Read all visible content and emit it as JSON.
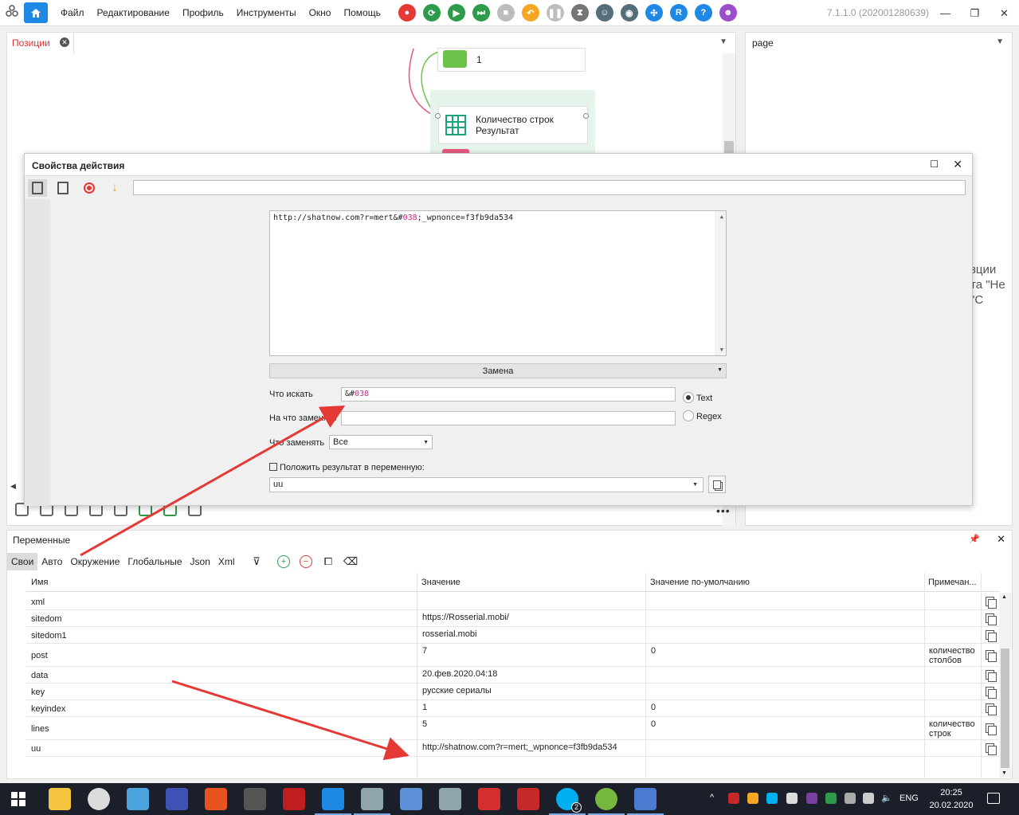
{
  "app": {
    "menu": [
      "Файл",
      "Редактирование",
      "Профиль",
      "Инструменты",
      "Окно",
      "Помощь"
    ],
    "version": "7.1.1.0 (202001280639)",
    "toolbar_letter": "R",
    "toolbar_help": "?",
    "toolbar_colors": [
      "#e53935",
      "#2e9b4a",
      "#2e9b4a",
      "#2e9b4a",
      "#bdbdbd",
      "#f5a623",
      "#bdbdbd",
      "#757575",
      "#546e7a",
      "#546e7a",
      "#1e88e5",
      "#1e88e5",
      "#1e88e5",
      "#9c4dcc"
    ]
  },
  "positions_panel": {
    "tab_label": "Позиции",
    "node1_label": "1",
    "node2_line1": "Количество строк",
    "node2_line2": "Результат"
  },
  "page_panel": {
    "title": "page",
    "partial_text": "зции\nта \"Не\n\"С"
  },
  "dialog": {
    "title": "Свойства действия",
    "comment_value": "",
    "text_prefix": "http://shatnow.com?r=mert&#",
    "text_highlight": "038",
    "text_suffix": ";_wpnonce=f3fb9da534",
    "mode": "Замена",
    "find_label": "Что искать",
    "find_prefix": "&#",
    "find_highlight": "038",
    "replace_label": "На что заменять",
    "replace_value": "",
    "radio_text": "Text",
    "radio_regex": "Regex",
    "radio_selected": "Text",
    "what_label": "Что заменять",
    "what_value": "Все",
    "result_label": "Положить результат в переменную:",
    "result_var": "uu"
  },
  "variables": {
    "title": "Переменные",
    "tabs": [
      "Свои",
      "Авто",
      "Окружение",
      "Глобальные",
      "Json",
      "Xml"
    ],
    "selected_tab": "Свои",
    "columns": [
      "Имя",
      "Значение",
      "Значение по-умолчанию",
      "Примечан..."
    ],
    "rows": [
      {
        "name": "xml",
        "value": "",
        "default": "",
        "note": ""
      },
      {
        "name": "sitedom",
        "value": "https://Rosserial.mobi/",
        "default": "",
        "note": ""
      },
      {
        "name": "sitedom1",
        "value": "rosserial.mobi",
        "default": "",
        "note": ""
      },
      {
        "name": "post",
        "value": "7",
        "default": "0",
        "note": "количество столбов"
      },
      {
        "name": "data",
        "value": "20.фев.2020.04:18",
        "default": "",
        "note": ""
      },
      {
        "name": "key",
        "value": "русские сериалы",
        "default": "",
        "note": ""
      },
      {
        "name": "keyindex",
        "value": "1",
        "default": "0",
        "note": ""
      },
      {
        "name": "lines",
        "value": "5",
        "default": "0",
        "note": "количество строк"
      },
      {
        "name": "uu",
        "value": "http://shatnow.com?r=mert;_wpnonce=f3fb9da534",
        "default": "",
        "note": ""
      }
    ]
  },
  "taskbar": {
    "skype_badge": "2",
    "language": "ENG",
    "time": "20:25",
    "date": "20.02.2020"
  },
  "colors": {
    "accent": "#1e88e5",
    "annotation_arrow": "#e53935",
    "highlight_text": "#c02b8a",
    "tab_active_text": "#dd3333"
  }
}
